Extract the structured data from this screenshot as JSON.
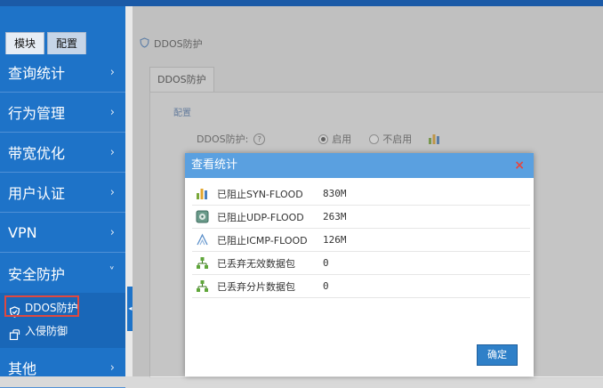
{
  "sidebar": {
    "tabs": [
      "模块",
      "配置"
    ],
    "menu": [
      {
        "label": "查询统计"
      },
      {
        "label": "行为管理"
      },
      {
        "label": "带宽优化"
      },
      {
        "label": "用户认证"
      },
      {
        "label": "VPN"
      },
      {
        "label": "安全防护"
      },
      {
        "label": "其他"
      }
    ],
    "submenu": [
      {
        "label": "DDOS防护"
      },
      {
        "label": "入侵防御"
      }
    ]
  },
  "main": {
    "breadcrumb": "DDOS防护",
    "tab": "DDOS防护",
    "section": "配置",
    "config_label": "DDOS防护:",
    "help": "?",
    "radio_on": "启用",
    "radio_off": "不启用"
  },
  "modal": {
    "title": "查看统计",
    "close": "×",
    "rows": [
      {
        "label": "已阻止SYN-FLOOD",
        "value": "830M"
      },
      {
        "label": "已阻止UDP-FLOOD",
        "value": "263M"
      },
      {
        "label": "已阻止ICMP-FLOOD",
        "value": "126M"
      },
      {
        "label": "已丢弃无效数据包",
        "value": "0"
      },
      {
        "label": "已丢弃分片数据包",
        "value": "0"
      }
    ],
    "ok": "确定"
  },
  "colors": {
    "sidebar": "#1e73c8",
    "modal_header": "#5aa0e0",
    "button": "#2f80c8",
    "highlight": "#e0483f"
  }
}
